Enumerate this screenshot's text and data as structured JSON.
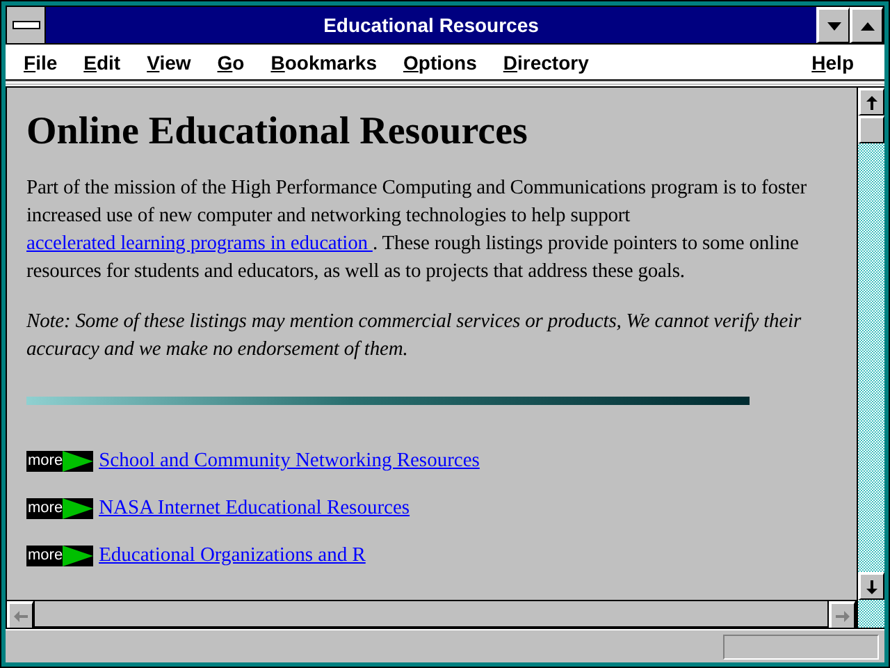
{
  "window": {
    "title": "Educational Resources"
  },
  "menu": [
    "File",
    "Edit",
    "View",
    "Go",
    "Bookmarks",
    "Options",
    "Directory"
  ],
  "help_menu": "Help",
  "page": {
    "heading": "Online Educational Resources",
    "intro_before": "Part of the mission of the High Performance Computing and Communications program is to foster increased use of new computer and networking technologies to help support ",
    "intro_link": "accelerated learning programs in education ",
    "intro_after": ". These rough listings provide pointers to some online resources for students and educators, as well as to projects that address these goals.",
    "note": "Note: Some of these listings may mention commercial services or products, We cannot verify their accuracy and we make no endorsement of them.",
    "links": [
      {
        "badge": "more",
        "label": "School and Community Networking Resources "
      },
      {
        "badge": "more",
        "label": "NASA Internet Educational Resources "
      },
      {
        "badge": "more",
        "label": "Educational Organizations and R"
      }
    ]
  }
}
